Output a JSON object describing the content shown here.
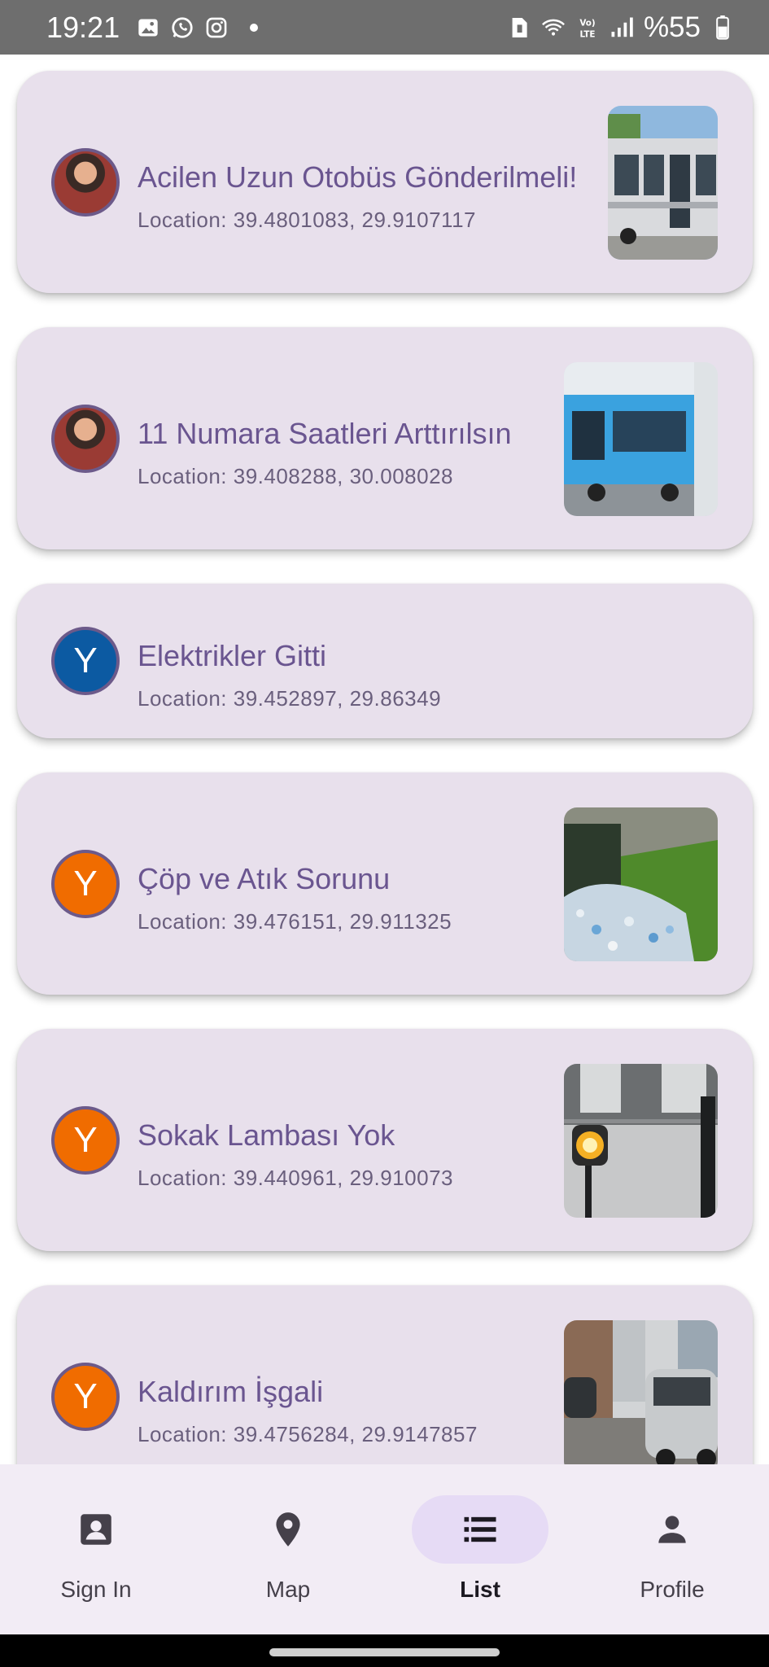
{
  "status_bar": {
    "time": "19:21",
    "battery": "%55",
    "volte_label": "VoLTE"
  },
  "cards": [
    {
      "title": "Acilen Uzun Otobüs Gönderilmeli!",
      "location": "Location: 39.4801083, 29.9107117",
      "avatar": "photo",
      "avatar_letter": "",
      "thumbnail": "bus-photo"
    },
    {
      "title": "11 Numara Saatleri Arttırılsın",
      "location": "Location: 39.408288, 30.008028",
      "avatar": "photo",
      "avatar_letter": "",
      "thumbnail": "blue-bus-photo"
    },
    {
      "title": "Elektrikler Gitti",
      "location": "Location: 39.452897, 29.86349",
      "avatar": "letter",
      "avatar_letter": "Y",
      "thumbnail": ""
    },
    {
      "title": "Çöp ve Atık Sorunu",
      "location": "Location: 39.476151, 29.911325",
      "avatar": "letter",
      "avatar_letter": "Y",
      "thumbnail": "garbage-photo"
    },
    {
      "title": "Sokak Lambası Yok",
      "location": "Location: 39.440961, 29.910073",
      "avatar": "letter",
      "avatar_letter": "Y",
      "thumbnail": "street-lamp-photo"
    },
    {
      "title": "Kaldırım İşgali",
      "location": "Location: 39.4756284, 29.9147857",
      "avatar": "letter",
      "avatar_letter": "Y",
      "thumbnail": "sidewalk-cars-photo"
    }
  ],
  "nav": {
    "items": [
      {
        "label": "Sign In",
        "icon": "contact-card-icon",
        "active": false
      },
      {
        "label": "Map",
        "icon": "map-pin-icon",
        "active": false
      },
      {
        "label": "List",
        "icon": "list-icon",
        "active": true
      },
      {
        "label": "Profile",
        "icon": "person-icon",
        "active": false
      }
    ]
  },
  "colors": {
    "card_bg": "#e8e0ec",
    "title": "#6a5590",
    "avatar_blue": "#0c5aa2",
    "avatar_orange": "#f06c00",
    "nav_bg": "#f2ecf5",
    "nav_active_pill": "#e6dbf5"
  }
}
